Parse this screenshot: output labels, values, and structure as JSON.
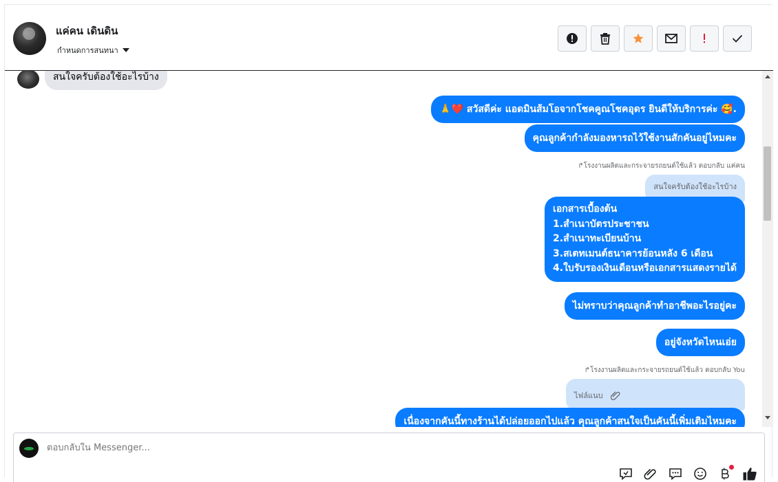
{
  "header": {
    "contact_name": "แค่คน เดินดิน",
    "label_select": "กำหนดการสนทนา",
    "actions": [
      {
        "name": "report-button",
        "icon": "exclamation-circle-icon"
      },
      {
        "name": "delete-button",
        "icon": "trash-icon"
      },
      {
        "name": "star-button",
        "icon": "star-icon",
        "color": "#f7923b"
      },
      {
        "name": "mark-unread-button",
        "icon": "envelope-icon"
      },
      {
        "name": "follow-up-button",
        "icon": "exclamation-icon",
        "color": "#e41e3f"
      },
      {
        "name": "mark-done-button",
        "icon": "checkmark-icon"
      }
    ]
  },
  "chat": {
    "incoming_partial": "สนใจครับต้องใช้อะไรบ้าง",
    "messages": [
      {
        "text": "🙏❤️ สวัสดีค่ะ แอดมินส้มโอจากโชคคูณโชคอุดร ยินดีให้บริการค่ะ 🥰."
      },
      {
        "text": "คุณลูกค้ากำลังมองหารถไว้ใช้งานสักคันอยู่ไหมคะ"
      }
    ],
    "reply_note_1": "↱โรงงานผลิตและกระจายรถยนต์ใช้แล้ว ตอบกลับ แค่คน",
    "quoted_1": "สนใจครับต้องใช้อะไรบ้าง",
    "documents_lines": [
      "เอกสารเบื้องต้น",
      "1.สำเนาบัตรประชาชน",
      "2.สำเนาทะเบียนบ้าน",
      "3.สเตทเมนต์ธนาคารย้อนหลัง 6 เดือน",
      "4.ใบรับรองเงินเดือนหรือเอกสารแสดงรายได้"
    ],
    "msg_occupation": "ไม่ทราบว่าคุณลูกค้าทำอาชีพอะไรอยู่คะ",
    "msg_province": "อยู่จังหวัดไหนเอ่ย",
    "reply_note_2": "↱โรงงานผลิตและกระจายรถยนต์ใช้แล้ว ตอบกลับ You",
    "quoted_2": "ไฟล์แนบ",
    "msg_last": "เนื่องจากคันนี้ทางร้านได้ปล่อยออกไปแล้ว คุณลูกค้าสนใจเป็นคันนี้เพิ่มเติมไหมคะ"
  },
  "composer": {
    "placeholder": "ตอบกลับใน Messenger...",
    "tools": [
      "saved-reply-icon",
      "paperclip-icon",
      "chat-bubble-icon",
      "emoji-icon",
      "bitcoin-icon",
      "like-icon"
    ]
  },
  "colors": {
    "outgoing_bubble": "#0a7cff",
    "quoted_bubble": "#cfe3fb",
    "incoming_bubble": "#e4e6eb"
  }
}
